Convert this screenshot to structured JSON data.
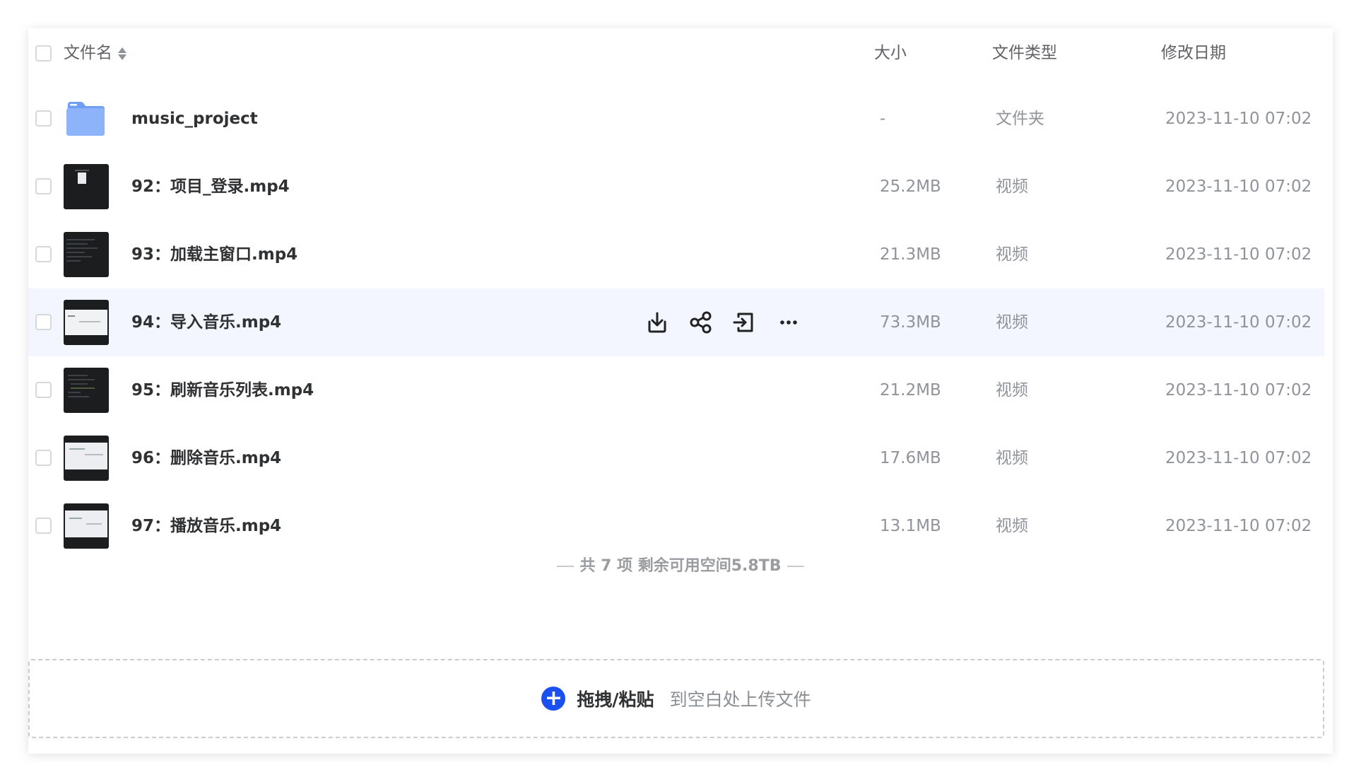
{
  "header": {
    "name_label": "文件名",
    "size_label": "大小",
    "type_label": "文件类型",
    "date_label": "修改日期"
  },
  "rows": [
    {
      "name": "music_project",
      "size": "-",
      "type": "文件夹",
      "date": "2023-11-10 07:02",
      "kind": "folder"
    },
    {
      "name": "92：项目_登录.mp4",
      "size": "25.2MB",
      "type": "视频",
      "date": "2023-11-10 07:02",
      "kind": "video"
    },
    {
      "name": "93：加载主窗口.mp4",
      "size": "21.3MB",
      "type": "视频",
      "date": "2023-11-10 07:02",
      "kind": "video"
    },
    {
      "name": "94：导入音乐.mp4",
      "size": "73.3MB",
      "type": "视频",
      "date": "2023-11-10 07:02",
      "kind": "video",
      "hovered": true
    },
    {
      "name": "95：刷新音乐列表.mp4",
      "size": "21.2MB",
      "type": "视频",
      "date": "2023-11-10 07:02",
      "kind": "video"
    },
    {
      "name": "96：删除音乐.mp4",
      "size": "17.6MB",
      "type": "视频",
      "date": "2023-11-10 07:02",
      "kind": "video"
    },
    {
      "name": "97：播放音乐.mp4",
      "size": "13.1MB",
      "type": "视频",
      "date": "2023-11-10 07:02",
      "kind": "video"
    }
  ],
  "row_actions": [
    "download-icon",
    "share-icon",
    "move-icon",
    "more-icon"
  ],
  "summary": "共 7 项 剩余可用空间5.8TB",
  "dropzone": {
    "bold_text": "拖拽/粘贴",
    "hint_text": "到空白处上传文件"
  },
  "colors": {
    "accent": "#1a4ff0",
    "hover_row": "#f3f6fe",
    "folder": "#7aa6f8"
  }
}
